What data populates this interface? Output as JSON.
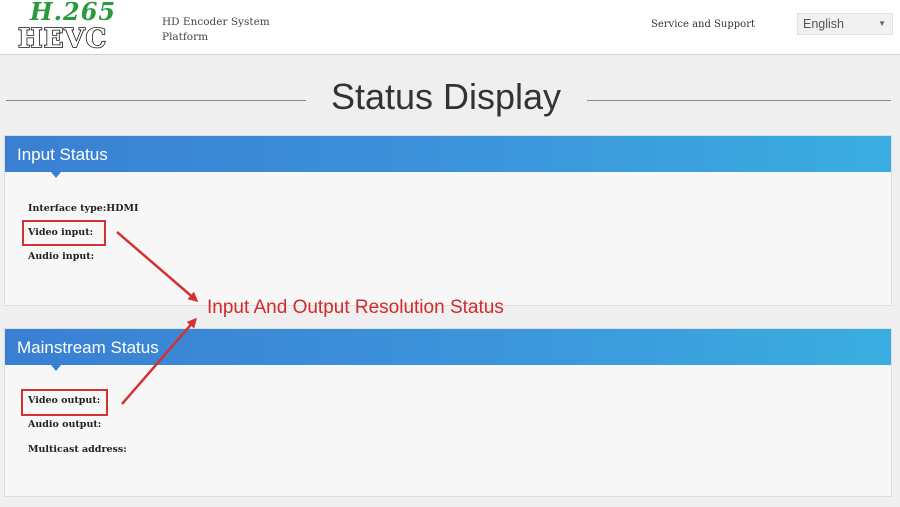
{
  "header": {
    "logo_top": "H.265",
    "logo_bottom": "HEVC",
    "platform_title": "HD Encoder System Platform",
    "support_link": "Service and Support",
    "language": "English"
  },
  "page": {
    "title": "Status Display"
  },
  "input_status": {
    "title": "Input Status",
    "interface_type": "Interface type:HDMI",
    "video_input": "Video input:",
    "audio_input": "Audio input:"
  },
  "mainstream_status": {
    "title": "Mainstream Status",
    "video_output": "Video output:",
    "audio_output": "Audio output:",
    "multicast_address": "Multicast address:"
  },
  "annotation": {
    "text": "Input And Output Resolution Status",
    "color": "#d22a2a"
  },
  "colors": {
    "panel_header": "#3c95db",
    "logo_green": "#2a9a3a"
  }
}
